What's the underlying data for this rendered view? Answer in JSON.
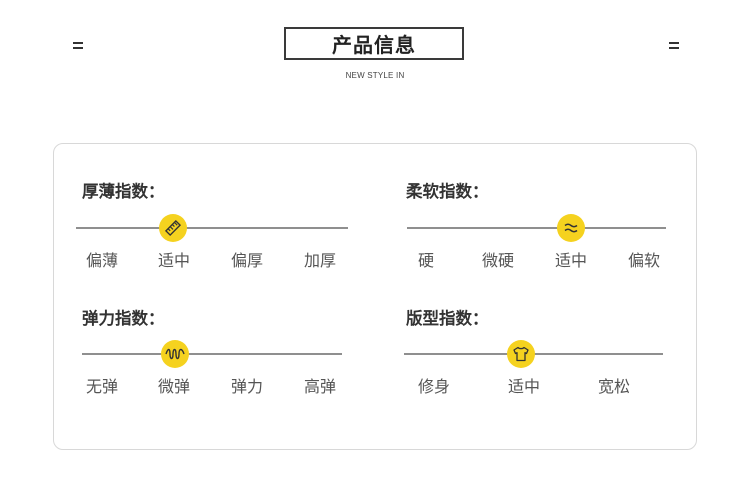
{
  "header": {
    "title": "产品信息",
    "subtitle": "NEW STYLE IN",
    "accent_color": "#f5d21f"
  },
  "metrics": {
    "thickness": {
      "title": "厚薄指数：",
      "options": [
        "偏薄",
        "适中",
        "偏厚",
        "加厚"
      ],
      "selected": "适中",
      "icon": "ruler-icon"
    },
    "softness": {
      "title": "柔软指数：",
      "options": [
        "硬",
        "微硬",
        "适中",
        "偏软"
      ],
      "selected": "适中",
      "icon": "wave-icon"
    },
    "elasticity": {
      "title": "弹力指数：",
      "options": [
        "无弹",
        "微弹",
        "弹力",
        "高弹"
      ],
      "selected": "微弹",
      "icon": "spring-icon"
    },
    "fit": {
      "title": "版型指数：",
      "options": [
        "修身",
        "适中",
        "宽松"
      ],
      "selected": "适中",
      "icon": "tshirt-icon"
    }
  }
}
